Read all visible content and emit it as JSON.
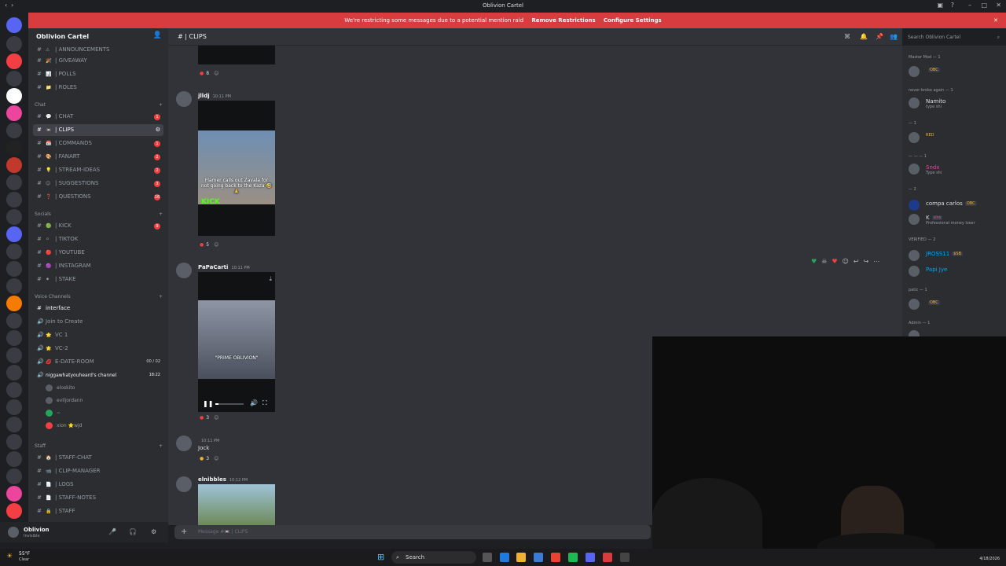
{
  "window": {
    "title": "Oblivion Cartel"
  },
  "banner": {
    "text": "We're restricting some messages due to a potential mention raid",
    "remove_label": "Remove Restrictions",
    "configure_label": "Configure Settings"
  },
  "server": {
    "name": "Oblivion Cartel"
  },
  "sidebar": {
    "top_channels": [
      {
        "label": "| ANNOUNCEMENTS",
        "emoji": "⚠"
      },
      {
        "label": "| GIVEAWAY",
        "emoji": "🎉"
      },
      {
        "label": "| POLLS",
        "emoji": "📊"
      },
      {
        "label": "| ROLES",
        "emoji": "📁"
      }
    ],
    "chat_category": "Chat",
    "chat_channels": [
      {
        "label": "| CHAT",
        "emoji": "💬",
        "badge": "1"
      },
      {
        "label": "| CLIPS",
        "emoji": "📼",
        "badge": ""
      },
      {
        "label": "| COMMANDS",
        "emoji": "📅",
        "badge": "1"
      },
      {
        "label": "| FANART",
        "emoji": "🎨",
        "badge": "2"
      },
      {
        "label": "| STREAM-IDEAS",
        "emoji": "💡",
        "badge": "2"
      },
      {
        "label": "| SUGGESTIONS",
        "emoji": "😊",
        "badge": "3"
      },
      {
        "label": "| QUESTIONS",
        "emoji": "❓",
        "badge": "16"
      }
    ],
    "socials_category": "Socials",
    "social_channels": [
      {
        "label": "| KICK",
        "emoji": "🟢",
        "badge": "9"
      },
      {
        "label": "| TIKTOK",
        "emoji": "⚪",
        "badge": ""
      },
      {
        "label": "| YOUTUBE",
        "emoji": "🔴",
        "badge": ""
      },
      {
        "label": "| INSTAGRAM",
        "emoji": "🟣",
        "badge": ""
      },
      {
        "label": "| STAKE",
        "emoji": "⚫",
        "badge": ""
      }
    ],
    "voice_category": "Voice Channels",
    "voice_channels": [
      {
        "label": "interface",
        "emoji": ""
      },
      {
        "label": "Join to Create",
        "emoji": ""
      },
      {
        "label": "VC 1",
        "emoji": "🌟"
      },
      {
        "label": "VC-2",
        "emoji": "🌟"
      },
      {
        "label": "E-DATE-ROOM",
        "emoji": "💋"
      },
      {
        "label": "niggawhatyouheard's channel",
        "emoji": ""
      }
    ],
    "vc_counter": "00 / 02",
    "vc_timer": "18:22",
    "vc_users": [
      "eloskito",
      "eviljordann",
      "~",
      "xion ⭐wjd"
    ],
    "staff_category": "Staff",
    "staff_channels": [
      {
        "label": "| STAFF-CHAT",
        "emoji": "🏠"
      },
      {
        "label": "| CLIP-MANAGER",
        "emoji": "📹"
      },
      {
        "label": "| LOGS",
        "emoji": "📄"
      },
      {
        "label": "| STAFF-NOTES",
        "emoji": "📄"
      },
      {
        "label": "| STAFF",
        "emoji": "🔒"
      }
    ]
  },
  "user_panel": {
    "name": "Oblivion",
    "status": "Invisible"
  },
  "chat_header": {
    "channel": "| CLIPS"
  },
  "search": {
    "placeholder": "Search Oblivion Cartel"
  },
  "messages": [
    {
      "author": "",
      "time": "",
      "reaction_count": "8"
    },
    {
      "author": "jlldj",
      "time": "10:11 PM",
      "caption": "Flamer calls out Zavala for not going back to the Kaza 🤣🙏",
      "kick": "KICK",
      "reaction_count": "5"
    },
    {
      "author": "PaPaCarti",
      "time": "10:11 PM",
      "caption": "\"PRIME OBLIVION\"",
      "reaction_count": "3",
      "video_progress": 0.1
    },
    {
      "author": "",
      "time": "10:11 PM",
      "text": "Jock",
      "reaction_count": "3"
    },
    {
      "author": "elnibbles",
      "time": "10:12 PM"
    }
  ],
  "composer": {
    "placeholder": "Message #📼 | CLIPS"
  },
  "members": {
    "groups": [
      {
        "role": "Master Mod — 1",
        "users": [
          {
            "name": "",
            "sub": "",
            "tag": "OBC",
            "color": "#c257ff"
          }
        ]
      },
      {
        "role": "never broke again — 1",
        "users": [
          {
            "name": "Namito",
            "sub": "type shi",
            "tag": "",
            "color": "#f2f3f5"
          }
        ]
      },
      {
        "role": "— 1",
        "users": [
          {
            "name": "RED",
            "sub": "",
            "tag": "",
            "color": "#f0b232"
          }
        ]
      },
      {
        "role": "— — — 1",
        "users": [
          {
            "name": "Sndx",
            "sub": "Type shi",
            "tag": "",
            "color": "#eb459e"
          }
        ]
      },
      {
        "role": "— 2",
        "users": [
          {
            "name": "compa carlos",
            "sub": "",
            "tag": "OBC",
            "color": "#f2f3f5"
          },
          {
            "name": "K",
            "sub": "Professional money loser",
            "tag": "sins",
            "color": "#f2f3f5"
          }
        ]
      },
      {
        "role": "VERIFIED — 2",
        "users": [
          {
            "name": "JROSS11",
            "sub": "",
            "tag": "$SB",
            "color": "#00a8fc"
          },
          {
            "name": "Papi Jye",
            "sub": "",
            "tag": "",
            "color": "#00a8fc"
          }
        ]
      },
      {
        "role": "patic — 1",
        "users": [
          {
            "name": "",
            "sub": "",
            "tag": "OBC",
            "color": "#f2f3f5"
          }
        ]
      },
      {
        "role": "Admin — 1",
        "users": [
          {
            "name": "",
            "sub": "",
            "tag": "",
            "color": "#c257ff"
          }
        ]
      }
    ]
  },
  "taskbar": {
    "weather_temp": "55°F",
    "weather_desc": "Clear",
    "search_label": "Search",
    "date": "4/18/2026"
  },
  "colors": {
    "accent": "#5865f2",
    "danger": "#d83c3e",
    "kick": "#53fc18"
  }
}
